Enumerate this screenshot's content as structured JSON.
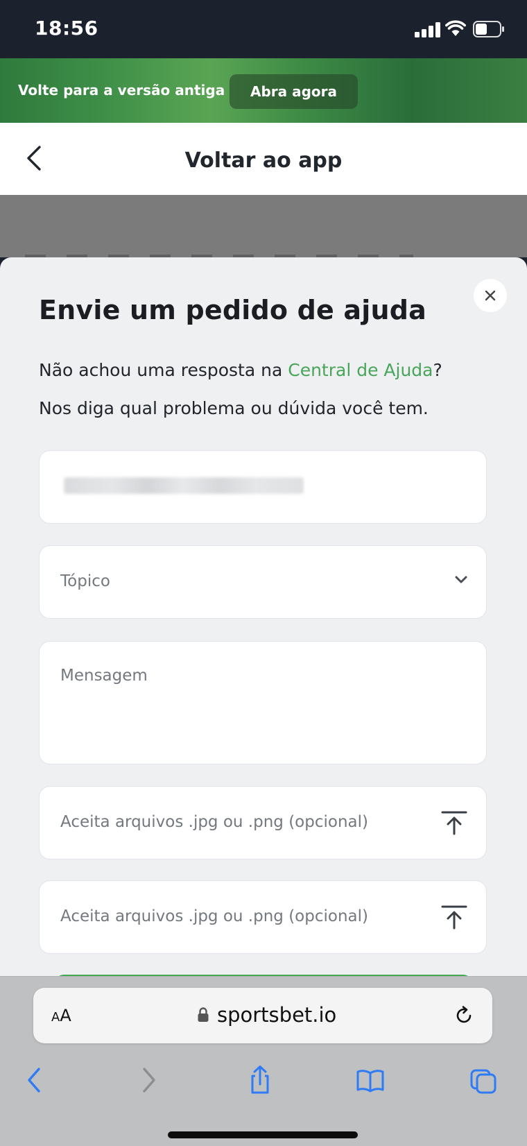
{
  "status_bar": {
    "time": "18:56"
  },
  "promo_banner": {
    "text": "Volte para a versão antiga",
    "button_label": "Abra agora"
  },
  "header": {
    "title": "Voltar ao app"
  },
  "modal": {
    "title": "Envie um pedido de ajuda",
    "intro_prefix": "Não achou uma resposta na ",
    "intro_link": "Central de Ajuda",
    "intro_suffix": "?",
    "intro_line2": "Nos diga qual problema ou dúvida você tem.",
    "topic_placeholder": "Tópico",
    "message_placeholder": "Mensagem",
    "attachment1_placeholder": "Aceita arquivos .jpg ou .png (opcional)",
    "attachment2_placeholder": "Aceita arquivos .jpg ou .png (opcional)"
  },
  "browser": {
    "text_size_small": "A",
    "text_size_large": "A",
    "url": "sportsbet.io"
  },
  "colors": {
    "accent_green": "#49a55a",
    "browser_blue": "#2f7bf5"
  }
}
